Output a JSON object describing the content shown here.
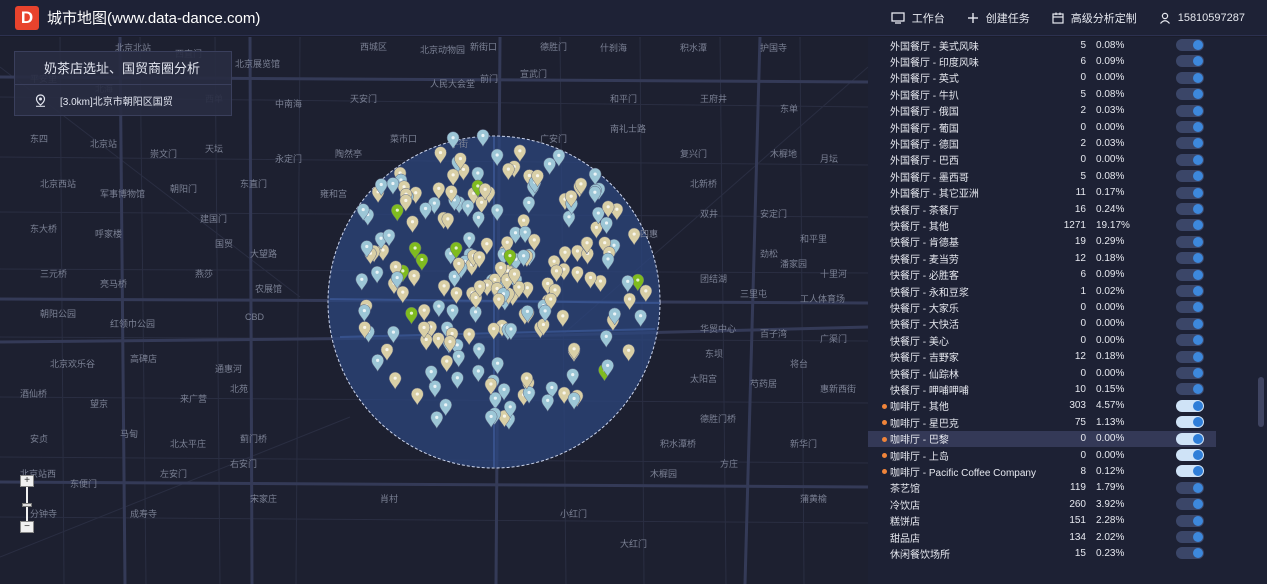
{
  "header": {
    "logo_letter": "D",
    "title": "城市地图(www.data-dance.com)",
    "nav": [
      {
        "label": "工作台",
        "icon": "monitor-icon"
      },
      {
        "label": "创建任务",
        "icon": "plus-icon"
      },
      {
        "label": "高级分析定制",
        "icon": "calendar-icon"
      },
      {
        "label": "15810597287",
        "icon": "user-icon"
      }
    ]
  },
  "info_panel": {
    "title": "奶茶店选址、国贸商圈分析",
    "location": "[3.0km]北京市朝阳区国贸"
  },
  "zoom": {
    "in": "+",
    "out": "−"
  },
  "map_labels": [
    "北京北站",
    "西直门",
    "北京展览馆",
    "西城区",
    "北京动物园",
    "新街口",
    "德胜门",
    "什刹海",
    "积水潭",
    "护国寺",
    "平安里",
    "北海",
    "西四",
    "西单",
    "中南海",
    "天安门",
    "人民大会堂",
    "前门",
    "宣武门",
    "和平门",
    "王府井",
    "东单",
    "东四",
    "北京站",
    "崇文门",
    "天坛",
    "永定门",
    "陶然亭",
    "菜市口",
    "牛街",
    "广安门",
    "南礼士路",
    "复兴门",
    "木樨地",
    "月坛",
    "北京西站",
    "军事博物馆",
    "朝阳门",
    "东直门",
    "雍和宫",
    "北新桥",
    "安定门",
    "和平里",
    "东大桥",
    "呼家楼",
    "建国门",
    "国贸",
    "大望路",
    "四惠",
    "双井",
    "劲松",
    "潘家园",
    "十里河",
    "三元桥",
    "亮马桥",
    "燕莎",
    "农展馆",
    "团结湖",
    "三里屯",
    "工人体育场",
    "朝阳公园",
    "红领巾公园",
    "CBD",
    "华贸中心",
    "百子湾",
    "广渠门",
    "北京欢乐谷",
    "高碑店",
    "通惠河",
    "东坝",
    "将台",
    "酒仙桥",
    "望京",
    "来广营",
    "北苑",
    "太阳宫",
    "芍药居",
    "惠新西街",
    "安贞",
    "马甸",
    "北太平庄",
    "蓟门桥",
    "积水潭桥",
    "德胜门桥",
    "新华门",
    "北京站西",
    "东便门",
    "左安门",
    "右安门",
    "木樨园",
    "方庄",
    "蒲黄榆",
    "分钟寺",
    "成寿寺",
    "宋家庄",
    "肖村",
    "小红门",
    "大红门"
  ],
  "categories": [
    {
      "name": "外国餐厅 - 美式风味",
      "count": "5",
      "pct": "0.08%",
      "dot": false,
      "selected": false,
      "on": false
    },
    {
      "name": "外国餐厅 - 印度风味",
      "count": "6",
      "pct": "0.09%",
      "dot": false,
      "selected": false,
      "on": false
    },
    {
      "name": "外国餐厅 - 英式",
      "count": "0",
      "pct": "0.00%",
      "dot": false,
      "selected": false,
      "on": false
    },
    {
      "name": "外国餐厅 - 牛扒",
      "count": "5",
      "pct": "0.08%",
      "dot": false,
      "selected": false,
      "on": false
    },
    {
      "name": "外国餐厅 - 俄国",
      "count": "2",
      "pct": "0.03%",
      "dot": false,
      "selected": false,
      "on": false
    },
    {
      "name": "外国餐厅 - 葡国",
      "count": "0",
      "pct": "0.00%",
      "dot": false,
      "selected": false,
      "on": false
    },
    {
      "name": "外国餐厅 - 德国",
      "count": "2",
      "pct": "0.03%",
      "dot": false,
      "selected": false,
      "on": false
    },
    {
      "name": "外国餐厅 - 巴西",
      "count": "0",
      "pct": "0.00%",
      "dot": false,
      "selected": false,
      "on": false
    },
    {
      "name": "外国餐厅 - 墨西哥",
      "count": "5",
      "pct": "0.08%",
      "dot": false,
      "selected": false,
      "on": false
    },
    {
      "name": "外国餐厅 - 其它亚洲",
      "count": "11",
      "pct": "0.17%",
      "dot": false,
      "selected": false,
      "on": false
    },
    {
      "name": "快餐厅 - 茶餐厅",
      "count": "16",
      "pct": "0.24%",
      "dot": false,
      "selected": false,
      "on": false
    },
    {
      "name": "快餐厅 - 其他",
      "count": "1271",
      "pct": "19.17%",
      "dot": false,
      "selected": false,
      "on": false
    },
    {
      "name": "快餐厅 - 肯德基",
      "count": "19",
      "pct": "0.29%",
      "dot": false,
      "selected": false,
      "on": false
    },
    {
      "name": "快餐厅 - 麦当劳",
      "count": "12",
      "pct": "0.18%",
      "dot": false,
      "selected": false,
      "on": false
    },
    {
      "name": "快餐厅 - 必胜客",
      "count": "6",
      "pct": "0.09%",
      "dot": false,
      "selected": false,
      "on": false
    },
    {
      "name": "快餐厅 - 永和豆浆",
      "count": "1",
      "pct": "0.02%",
      "dot": false,
      "selected": false,
      "on": false
    },
    {
      "name": "快餐厅 - 大家乐",
      "count": "0",
      "pct": "0.00%",
      "dot": false,
      "selected": false,
      "on": false
    },
    {
      "name": "快餐厅 - 大快活",
      "count": "0",
      "pct": "0.00%",
      "dot": false,
      "selected": false,
      "on": false
    },
    {
      "name": "快餐厅 - 美心",
      "count": "0",
      "pct": "0.00%",
      "dot": false,
      "selected": false,
      "on": false
    },
    {
      "name": "快餐厅 - 吉野家",
      "count": "12",
      "pct": "0.18%",
      "dot": false,
      "selected": false,
      "on": false
    },
    {
      "name": "快餐厅 - 仙踪林",
      "count": "0",
      "pct": "0.00%",
      "dot": false,
      "selected": false,
      "on": false
    },
    {
      "name": "快餐厅 - 呷哺呷哺",
      "count": "10",
      "pct": "0.15%",
      "dot": false,
      "selected": false,
      "on": false
    },
    {
      "name": "咖啡厅 - 其他",
      "count": "303",
      "pct": "4.57%",
      "dot": true,
      "selected": false,
      "on": true
    },
    {
      "name": "咖啡厅 - 星巴克",
      "count": "75",
      "pct": "1.13%",
      "dot": true,
      "selected": false,
      "on": true
    },
    {
      "name": "咖啡厅 - 巴黎",
      "count": "0",
      "pct": "0.00%",
      "dot": true,
      "selected": true,
      "on": true
    },
    {
      "name": "咖啡厅 - 上岛",
      "count": "0",
      "pct": "0.00%",
      "dot": true,
      "selected": false,
      "on": true
    },
    {
      "name": "咖啡厅 - Pacific Coffee Company",
      "count": "8",
      "pct": "0.12%",
      "dot": true,
      "selected": false,
      "on": true
    },
    {
      "name": "茶艺馆",
      "count": "119",
      "pct": "1.79%",
      "dot": false,
      "selected": false,
      "on": false
    },
    {
      "name": "冷饮店",
      "count": "260",
      "pct": "3.92%",
      "dot": false,
      "selected": false,
      "on": false
    },
    {
      "name": "糕饼店",
      "count": "151",
      "pct": "2.28%",
      "dot": false,
      "selected": false,
      "on": false
    },
    {
      "name": "甜品店",
      "count": "134",
      "pct": "2.02%",
      "dot": false,
      "selected": false,
      "on": false
    },
    {
      "name": "休闲餐饮场所",
      "count": "15",
      "pct": "0.23%",
      "dot": false,
      "selected": false,
      "on": false
    }
  ],
  "colors": {
    "header_bg": "#1e2236",
    "map_bg": "#1d2030",
    "radius_fill": "#2d4780",
    "pin_beige": "#d9cfa6",
    "pin_blue": "#9cc6d6",
    "pin_green": "#7fbb1f",
    "dot_orange": "#f0843a",
    "toggle_blue": "#2f7ed8"
  }
}
